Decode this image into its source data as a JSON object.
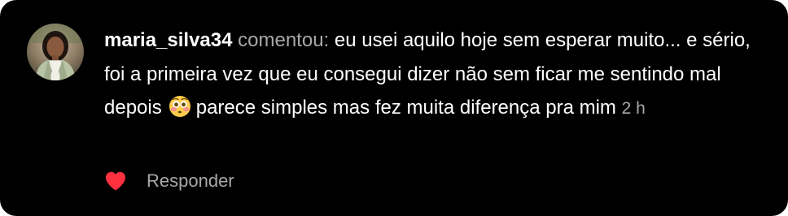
{
  "comment": {
    "username": "maria_silva34",
    "verb": "comentou:",
    "text_before_emoji": "eu usei aquilo hoje sem esperar muito... e sério, foi a primeira vez que eu consegui dizer não sem ficar me sentindo mal depois",
    "emoji": "flushed-face",
    "text_after_emoji": "parece simples mas fez muita diferença pra mim",
    "timestamp": "2 h"
  },
  "actions": {
    "like_icon": "heart-icon",
    "like_color": "#ff3040",
    "reply_label": "Responder"
  },
  "colors": {
    "background": "#000000",
    "text": "#ffffff",
    "muted": "#a8a8a8"
  }
}
